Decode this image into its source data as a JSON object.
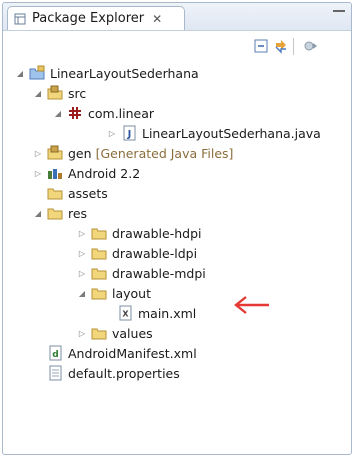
{
  "tab": {
    "title": "Package Explorer",
    "close": "✕"
  },
  "tree": {
    "project": "LinearLayoutSederhana",
    "src": "src",
    "package": "com.linear",
    "java_file": "LinearLayoutSederhana.java",
    "gen": "gen",
    "gen_decoration": "[Generated Java Files]",
    "android": "Android 2.2",
    "assets": "assets",
    "res": "res",
    "drawable_hdpi": "drawable-hdpi",
    "drawable_ldpi": "drawable-ldpi",
    "drawable_mdpi": "drawable-mdpi",
    "layout": "layout",
    "main_xml": "main.xml",
    "values": "values",
    "manifest": "AndroidManifest.xml",
    "default_properties": "default.properties"
  },
  "colors": {
    "arrow": "#e53935",
    "folder": "#e8c15a",
    "package": "#9b1c1c"
  }
}
